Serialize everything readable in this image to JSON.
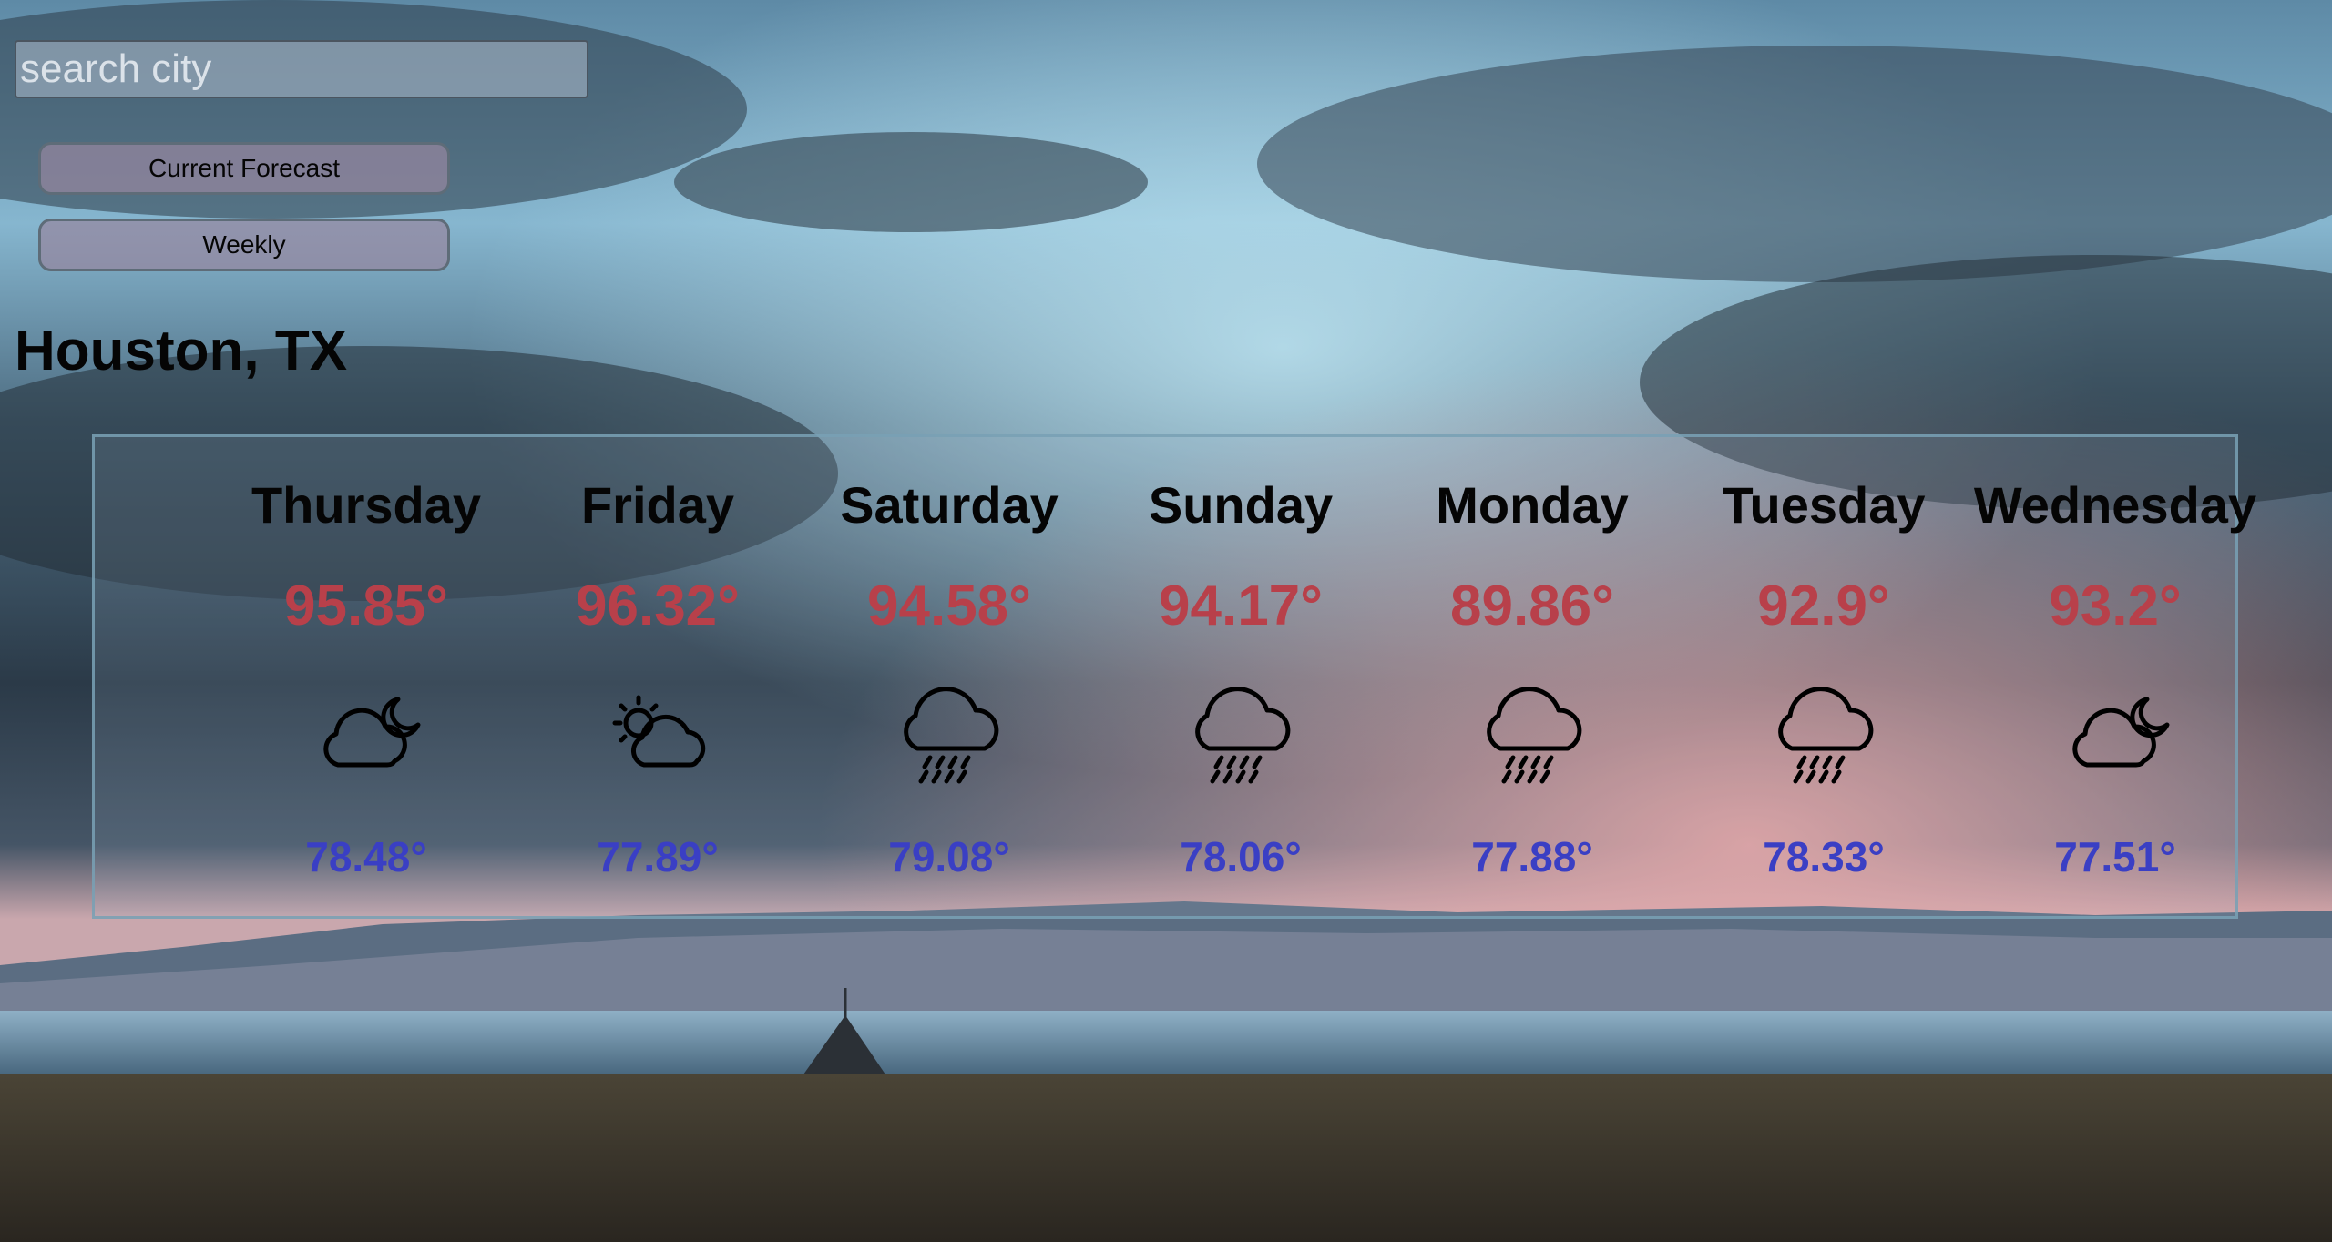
{
  "search": {
    "placeholder": "search city",
    "value": ""
  },
  "nav": {
    "current_label": "Current Forecast",
    "weekly_label": "Weekly"
  },
  "location": {
    "city": "Houston, TX"
  },
  "colors": {
    "high_temp": "#b8404a",
    "low_temp": "#3a3fc4",
    "text": "#050505"
  },
  "forecast": [
    {
      "day": "Thursday",
      "high": "95.85°",
      "low": "78.48°",
      "icon": "night-cloud-icon"
    },
    {
      "day": "Friday",
      "high": "96.32°",
      "low": "77.89°",
      "icon": "partly-sunny-icon"
    },
    {
      "day": "Saturday",
      "high": "94.58°",
      "low": "79.08°",
      "icon": "rain-icon"
    },
    {
      "day": "Sunday",
      "high": "94.17°",
      "low": "78.06°",
      "icon": "rain-icon"
    },
    {
      "day": "Monday",
      "high": "89.86°",
      "low": "77.88°",
      "icon": "rain-icon"
    },
    {
      "day": "Tuesday",
      "high": "92.9°",
      "low": "78.33°",
      "icon": "rain-icon"
    },
    {
      "day": "Wednesday",
      "high": "93.2°",
      "low": "77.51°",
      "icon": "night-cloud-icon"
    }
  ]
}
